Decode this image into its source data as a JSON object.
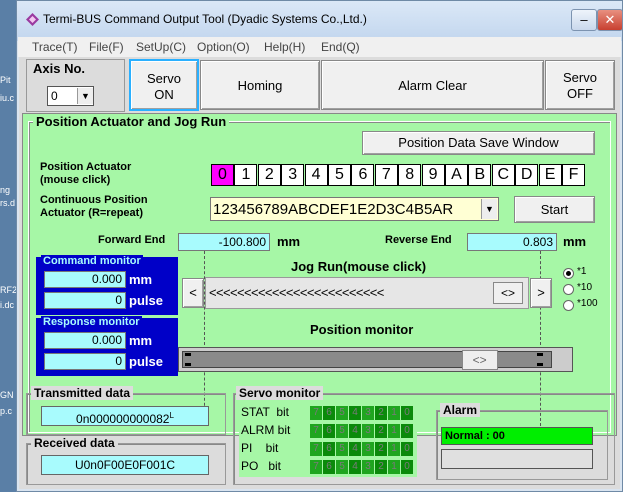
{
  "window": {
    "title": "Termi-BUS Command Output Tool (Dyadic Systems Co.,Ltd.)"
  },
  "title_buttons": {
    "minimize": "–",
    "maximize": "□",
    "close": "✕"
  },
  "desktop_strip": [
    "Pit",
    "iu.c",
    "ng",
    "rs.d",
    "RF2",
    "i.dc",
    "GN",
    "p.c"
  ],
  "menu": [
    "Trace(T)",
    "File(F)",
    "SetUp(C)",
    "Option(O)",
    "Help(H)",
    "End(Q)"
  ],
  "axis": {
    "label": "Axis No.",
    "value": "0"
  },
  "top_buttons": {
    "servo_on": [
      "Servo",
      "ON"
    ],
    "homing": "Homing",
    "alarm_clear": "Alarm Clear",
    "servo_off": [
      "Servo",
      "OFF"
    ]
  },
  "position_panel": {
    "title": "Position Actuator and Jog Run",
    "save_window_button": "Position Data Save Window",
    "actuator_label": [
      "Position Actuator",
      "(mouse click)"
    ],
    "hex_buttons": [
      "0",
      "1",
      "2",
      "3",
      "4",
      "5",
      "6",
      "7",
      "8",
      "9",
      "A",
      "B",
      "C",
      "D",
      "E",
      "F"
    ],
    "selected_hex": "0",
    "continuous_label": [
      "Continuous Position",
      "Actuator  (R=repeat)"
    ],
    "continuous_value": "123456789ABCDEF1E2D3C4B5AR",
    "start_button": "Start",
    "forward_end_label": "Forward End",
    "forward_end_value": "-100.800",
    "forward_end_unit": "mm",
    "reverse_end_label": "Reverse End",
    "reverse_end_value": "0.803",
    "reverse_end_unit": "mm",
    "jog_title": "Jog Run(mouse click)",
    "jog_arrows": "<<<<<<<<<<<<<<<<<<<<<<<<<",
    "jog_thumb": "<>",
    "jog_left": "<",
    "jog_right": ">",
    "speed_options": [
      "*1",
      "*10",
      "*100"
    ],
    "speed_selected": "*1",
    "position_monitor_title": "Position monitor",
    "position_monitor_thumb": "<>",
    "position_monitor_level": 0.86
  },
  "command_monitor": {
    "title": "Command monitor",
    "mm_value": "0.000",
    "mm_unit": "mm",
    "pulse_value": "0",
    "pulse_unit": "pulse"
  },
  "response_monitor": {
    "title": "Response monitor",
    "mm_value": "0.000",
    "mm_unit": "mm",
    "pulse_value": "0",
    "pulse_unit": "pulse"
  },
  "transmitted": {
    "title": "Transmitted data",
    "value": "0n000000000082",
    "suffix": "L"
  },
  "received": {
    "title": "Received data",
    "value": "U0n0F00E0F001C"
  },
  "servo_monitor": {
    "title": "Servo monitor",
    "rows": [
      {
        "label": "STAT  bit",
        "bits": [
          "7",
          "6",
          "5",
          "4",
          "3",
          "2",
          "1",
          "0"
        ]
      },
      {
        "label": "ALRM bit",
        "bits": [
          "7",
          "6",
          "5",
          "4",
          "3",
          "2",
          "1",
          "0"
        ]
      },
      {
        "label": "PI    bit",
        "bits": [
          "7",
          "6",
          "5",
          "4",
          "3",
          "2",
          "1",
          "0"
        ]
      },
      {
        "label": "PO   bit",
        "bits": [
          "7",
          "6",
          "5",
          "4",
          "3",
          "2",
          "1",
          "0"
        ]
      }
    ]
  },
  "alarm": {
    "title": "Alarm",
    "status": "Normal : 00",
    "detail": ""
  },
  "colors": {
    "panel_green": "#a6f7a6",
    "field_cyan": "#a8fbfd",
    "monitor_blue": "#0000c8",
    "hex_selected": "#ff00ff",
    "alarm_green": "#00ee00"
  }
}
